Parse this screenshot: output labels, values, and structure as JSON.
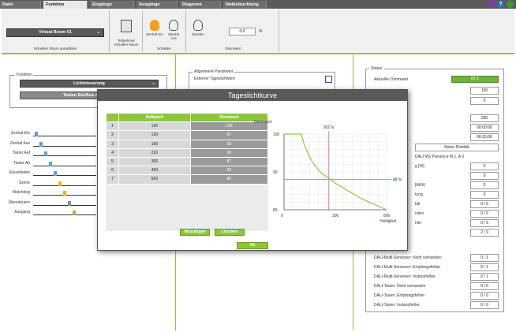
{
  "tabs": [
    "Datei",
    "Funktion",
    "Eingänge",
    "Ausgänge",
    "Diagnose",
    "Notbeleuchtung"
  ],
  "ribbon": {
    "room_select": "Virtual Room 01",
    "room_group_label": "Virtuellen Raum auswählen",
    "participants_label": "Teilnehmer Virtueller Raum",
    "central_on": "Zentral Ein",
    "central_off": "Zentral Aus",
    "switch_group_label": "Schalten",
    "send_label": "Senden",
    "dim_value": "0.0",
    "dim_unit": "%",
    "dim_group_label": "Dimmwert"
  },
  "left": {
    "function_legend": "Funktion",
    "function_select": "Lichtsteuerung",
    "button_select": "Tasten Ein/Aus mit Tages",
    "signals": [
      "Zentral Ein",
      "Zentral Aus",
      "Taster Auf",
      "Taster Ab",
      "Einzeltaster",
      "Szene",
      "Watchdog",
      "Übersteuern",
      "Ausgang"
    ]
  },
  "middle": {
    "legend": "Allgemeine Parameter",
    "ext_daylight": "Externer Tageslichtwert"
  },
  "status": {
    "legend": "Status",
    "current_dim_label": "Aktueller Dimmwert",
    "current_dim_value": "87.2",
    "v1": "100",
    "v2": "0",
    "v3": "260",
    "t1": "00:00:00",
    "t2": "00:15:00",
    "priority": "Keine Priorität",
    "sensor": "DALI MS Presence M 1, A 0",
    "partials": [
      "g [W]",
      "",
      "[kWh]",
      "tung",
      "fall",
      "nden",
      "hler"
    ],
    "partial_vals": [
      "0",
      "0",
      "0",
      "0",
      "0 / 0",
      "0 / 0",
      "0 / 9",
      "2 / 9"
    ],
    "rows": [
      {
        "label": "DALI-Multi-Sensoren: Nicht vorhanden",
        "value": "0 / 1"
      },
      {
        "label": "DALI-Multi-Sensoren: Empfangsfehler",
        "value": "0 / 1"
      },
      {
        "label": "DALI-Multi-Sensoren: Instanzfehler",
        "value": "0 / 1"
      },
      {
        "label": "DALI-Taster: Nicht vorhanden",
        "value": "0 / 0"
      },
      {
        "label": "DALI-Taster: Empfangsfehler",
        "value": "0 / 0"
      },
      {
        "label": "DALI-Taster: Instanzfehler",
        "value": "0 / 0"
      }
    ]
  },
  "dialog": {
    "title": "Tageslichtkurve",
    "col_brightness": "Helligkeit",
    "col_dim": "Dimmwert",
    "table": [
      [
        1,
        100,
        100
      ],
      [
        2,
        120,
        97
      ],
      [
        3,
        160,
        93
      ],
      [
        4,
        210,
        90
      ],
      [
        5,
        300,
        87
      ],
      [
        6,
        450,
        83
      ],
      [
        7,
        600,
        80
      ]
    ],
    "add_button": "Hinzufügen",
    "delete_button": "Löschen",
    "ok_button": "Ok"
  },
  "chart_data": {
    "type": "line",
    "ylabel": "Dimmwert",
    "xlabel": "Helligkeit",
    "xlim": [
      0,
      600
    ],
    "ylim": [
      80,
      100
    ],
    "x_ticks": [
      "0",
      "300",
      "600"
    ],
    "y_ticks": [
      "100",
      "90",
      "80"
    ],
    "series": [
      {
        "x": [
          0,
          100,
          120,
          160,
          210,
          300,
          450,
          600
        ],
        "values": [
          100,
          100,
          97,
          93,
          90,
          87,
          83,
          80
        ]
      }
    ],
    "marker_x_label": "262 lx",
    "marker_x": 262,
    "marker_y_label": "88 %",
    "marker_y": 88,
    "colors": {
      "line": "#8cc63f",
      "marker": "#e05a7a"
    }
  }
}
